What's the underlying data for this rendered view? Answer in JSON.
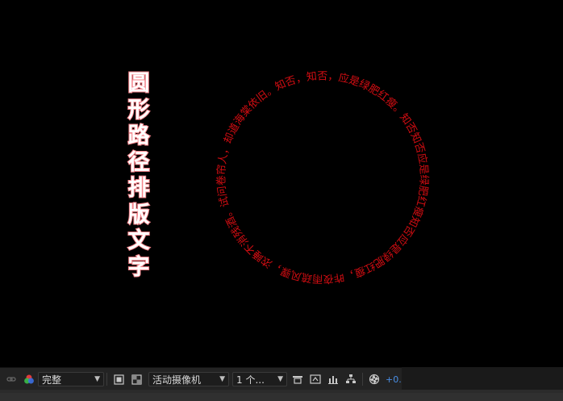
{
  "vertical_title": [
    "圆",
    "形",
    "路",
    "径",
    "排",
    "版",
    "文",
    "字"
  ],
  "circle_text": "应是绿肥红瘦，昨夜雨疏风骤，浓睡不消残酒。试问卷帘人，却道海棠依旧。知否，知否，应是绿肥红瘦。知否知否应是绿肥红瘦知否",
  "colors": {
    "viewport_bg": "#000000",
    "circle_text": "#d20d12",
    "title_fill": "#ffffff",
    "title_stroke": "#f3838a",
    "toolbar_bg": "#232323",
    "exposure_value": "#4a8fe6"
  },
  "toolbar": {
    "resolution": "完整",
    "camera": "活动摄像机",
    "views": "1 个...",
    "exposure": "+0.0",
    "icons": [
      "link-icon",
      "color-channels-icon",
      "region-of-interest-icon",
      "transparency-grid-icon",
      "views-layout-icon",
      "3d-draft-icon",
      "snapshot-icon",
      "flowchart-icon",
      "reset-exposure-icon"
    ]
  }
}
